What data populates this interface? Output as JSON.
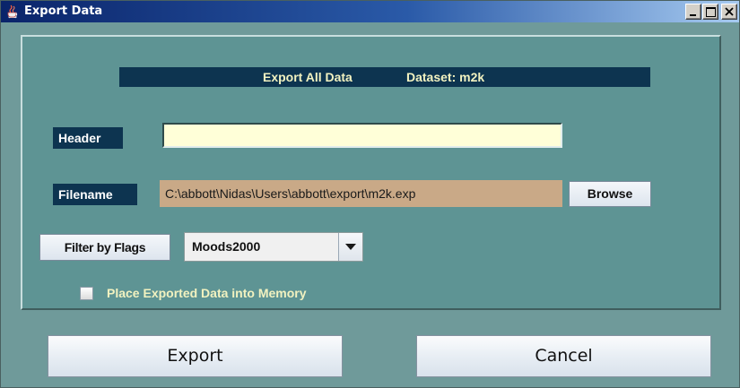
{
  "window": {
    "title": "Export Data",
    "icon": "java-coffee-cup-icon",
    "controls": [
      "minimize-icon",
      "maximize-icon",
      "close-icon"
    ]
  },
  "banner": {
    "title": "Export All Data",
    "dataset": "Dataset: m2k"
  },
  "form": {
    "header_label": "Header",
    "header_value": "",
    "filename_label": "Filename",
    "filename_value": "C:\\abbott\\Nidas\\Users\\abbott\\export\\m2k.exp",
    "browse_label": "Browse",
    "filter_label": "Filter by Flags",
    "filter_selected": "Moods2000",
    "memory_checkbox_label": "Place Exported Data into Memory",
    "memory_checkbox_checked": false
  },
  "actions": {
    "export_label": "Export",
    "cancel_label": "Cancel"
  },
  "colors": {
    "window_bg": "#6f9a9a",
    "panel_bg": "#5e9494",
    "label_bg": "#0d3450",
    "banner_text": "#f2f2c0",
    "header_input_bg": "#ffffd8",
    "filename_bg": "#c9a987"
  }
}
